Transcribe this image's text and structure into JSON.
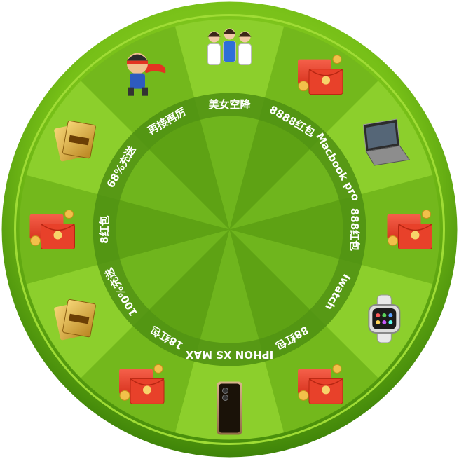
{
  "wheel": {
    "colors": {
      "rim_outer": "#4f9a0c",
      "rim_inner": "#8fd21f",
      "segment_light": "#8ccf2c",
      "segment_dark": "#73b81c",
      "hub_light": "#6fb51d",
      "hub_dark": "#5ea214",
      "label_ring": "#4e8f12",
      "label_text": "#ffffff"
    },
    "segments": [
      {
        "label": "美女空降",
        "prize_icon": "girls-group-icon"
      },
      {
        "label": "8888红包",
        "prize_icon": "red-envelope-icon"
      },
      {
        "label": "Macbook pro",
        "prize_icon": "laptop-icon"
      },
      {
        "label": "888红包",
        "prize_icon": "red-envelope-icon"
      },
      {
        "label": "Iwatch",
        "prize_icon": "smartwatch-icon"
      },
      {
        "label": "88红包",
        "prize_icon": "red-envelope-icon"
      },
      {
        "label": "IPHON XS MAX",
        "prize_icon": "smartphone-icon"
      },
      {
        "label": "18红包",
        "prize_icon": "red-envelope-icon"
      },
      {
        "label": "100%充送",
        "prize_icon": "coupon-icon"
      },
      {
        "label": "8红包",
        "prize_icon": "red-envelope-icon"
      },
      {
        "label": "68%充送",
        "prize_icon": "coupon-icon"
      },
      {
        "label": "再接再厉",
        "prize_icon": "superhero-icon"
      }
    ]
  }
}
